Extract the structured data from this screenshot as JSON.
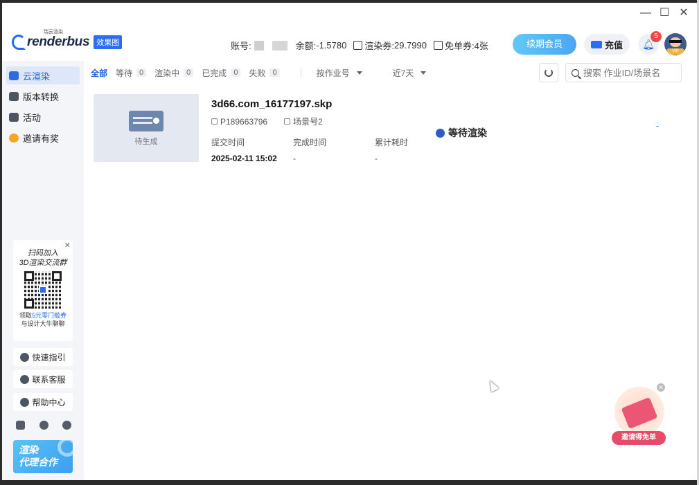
{
  "window": {
    "minimize": "—",
    "maximize": "☐",
    "close": "✕"
  },
  "header": {
    "logo_small": "瑞云渲染",
    "logo_brand": "renderbus",
    "logo_tag": "效果图",
    "account_label": "账号:",
    "balance_label": "余额:",
    "balance_value": "-1.5780",
    "render_voucher_label": "渲染券:",
    "render_voucher_value": "29.7990",
    "free_voucher_label": "免单券:",
    "free_voucher_value": "4张",
    "renew_vip": "续期会员",
    "recharge": "充值",
    "notification_count": "5",
    "avatar_badge": "VIP"
  },
  "sidebar": {
    "items": [
      {
        "label": "云渲染",
        "icon": "cloud-icon",
        "active": true
      },
      {
        "label": "版本转换",
        "icon": "briefcase-icon",
        "active": false
      },
      {
        "label": "活动",
        "icon": "user-icon",
        "active": false
      },
      {
        "label": "邀请有奖",
        "icon": "gift-icon",
        "active": false
      }
    ],
    "promo": {
      "line1": "扫码加入",
      "line2": "3D渲染交流群",
      "text3_prefix": "领取",
      "text3_highlight": "5元零门槛券",
      "text4": "与设计大牛聊聊"
    },
    "buttons": {
      "quick_guide": "快速指引",
      "contact": "联系客服",
      "help": "帮助中心"
    },
    "agent_banner": {
      "line1": "渲染",
      "line2": "代理合作"
    }
  },
  "filters": {
    "tabs": [
      {
        "label": "全部",
        "count": ""
      },
      {
        "label": "等待",
        "count": "0"
      },
      {
        "label": "渲染中",
        "count": "0"
      },
      {
        "label": "已完成",
        "count": "0"
      },
      {
        "label": "失败",
        "count": "0"
      }
    ],
    "sort_by": "按作业号",
    "date_range": "近7天",
    "search_placeholder": "搜索 作业ID/场景名"
  },
  "job": {
    "thumb_label": "待生成",
    "name": "3d66.com_16177197.skp",
    "project_id": "P189663796",
    "scene": "场景号2",
    "submit_time_label": "提交时间",
    "submit_time": "2025-02-11 15:02",
    "complete_time_label": "完成时间",
    "complete_time": "-",
    "elapsed_label": "累计耗时",
    "elapsed": "-",
    "status": "等待渲染",
    "progress": "-"
  },
  "gift_widget": {
    "label": "邀请得免单"
  }
}
